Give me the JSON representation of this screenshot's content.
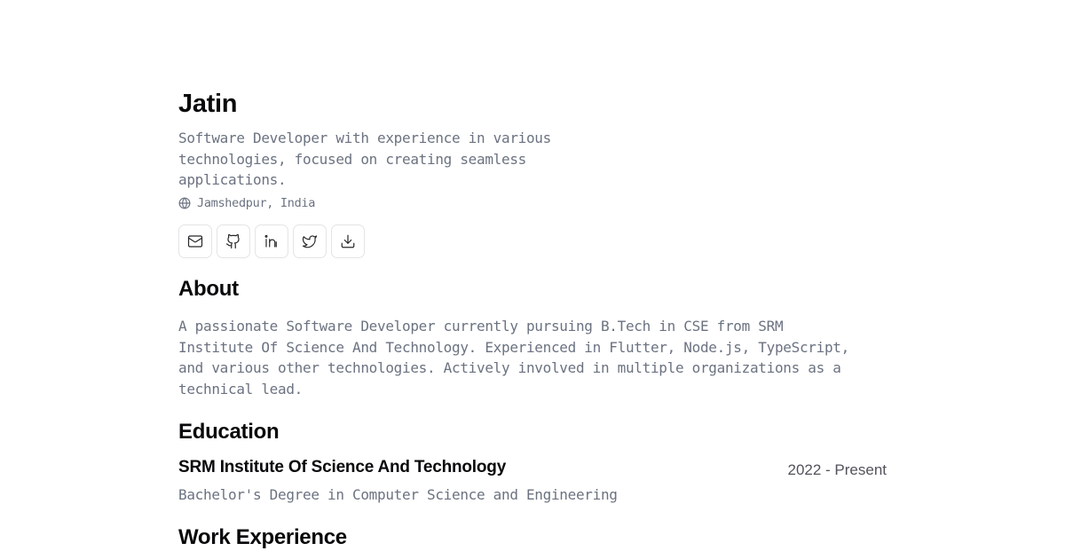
{
  "header": {
    "name": "Jatin",
    "tagline": "Software Developer with experience in various technologies, focused on creating seamless applications.",
    "location": "Jamshedpur, India",
    "location_icon": "globe-icon"
  },
  "socials": [
    {
      "name": "email",
      "icon": "mail-icon"
    },
    {
      "name": "github",
      "icon": "github-icon"
    },
    {
      "name": "linkedin",
      "icon": "linkedin-icon"
    },
    {
      "name": "twitter",
      "icon": "twitter-icon"
    },
    {
      "name": "resume-download",
      "icon": "download-icon"
    }
  ],
  "about": {
    "title": "About",
    "text": "A passionate Software Developer currently pursuing B.Tech in CSE from SRM Institute Of Science And Technology. Experienced in Flutter, Node.js, TypeScript, and various other technologies. Actively involved in multiple organizations as a technical lead."
  },
  "education": {
    "title": "Education",
    "items": [
      {
        "school": "SRM Institute Of Science And Technology",
        "dates": "2022 - Present",
        "degree": "Bachelor's Degree in Computer Science and Engineering"
      }
    ]
  },
  "work": {
    "title": "Work Experience"
  },
  "colors": {
    "text_primary": "#09090b",
    "text_muted": "#6b7280",
    "border": "#e4e4e7",
    "background": "#ffffff"
  }
}
